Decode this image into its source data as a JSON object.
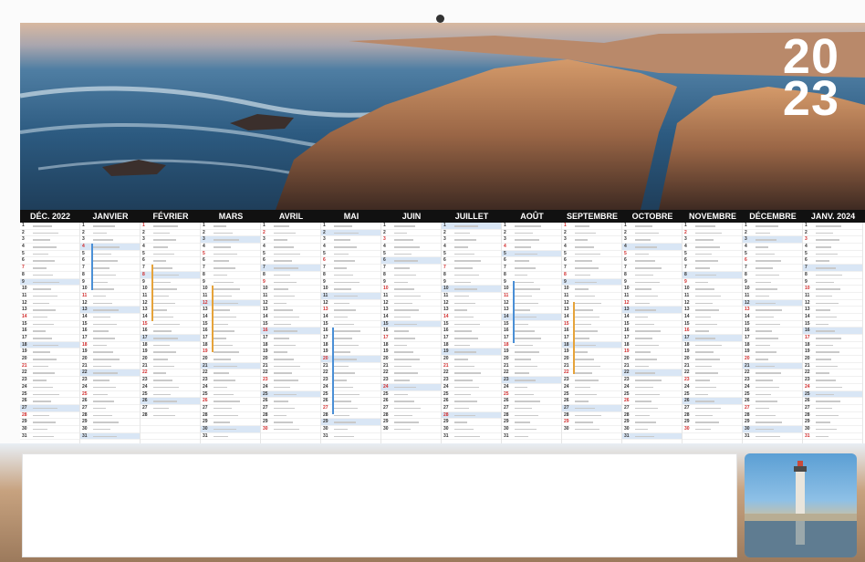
{
  "calendar": {
    "year_top": "20",
    "year_bottom": "23",
    "months": [
      "DÉC. 2022",
      "JANVIER",
      "FÉVRIER",
      "MARS",
      "AVRIL",
      "MAI",
      "JUIN",
      "JUILLET",
      "AOÛT",
      "SEPTEMBRE",
      "OCTOBRE",
      "NOVEMBRE",
      "DÉCEMBRE",
      "JANV. 2024"
    ],
    "colors": {
      "header_bg": "#111111",
      "sunday_red": "#d12b2b",
      "highlight_blue": "#d9e6f5",
      "month_text": "#ffffff"
    }
  }
}
